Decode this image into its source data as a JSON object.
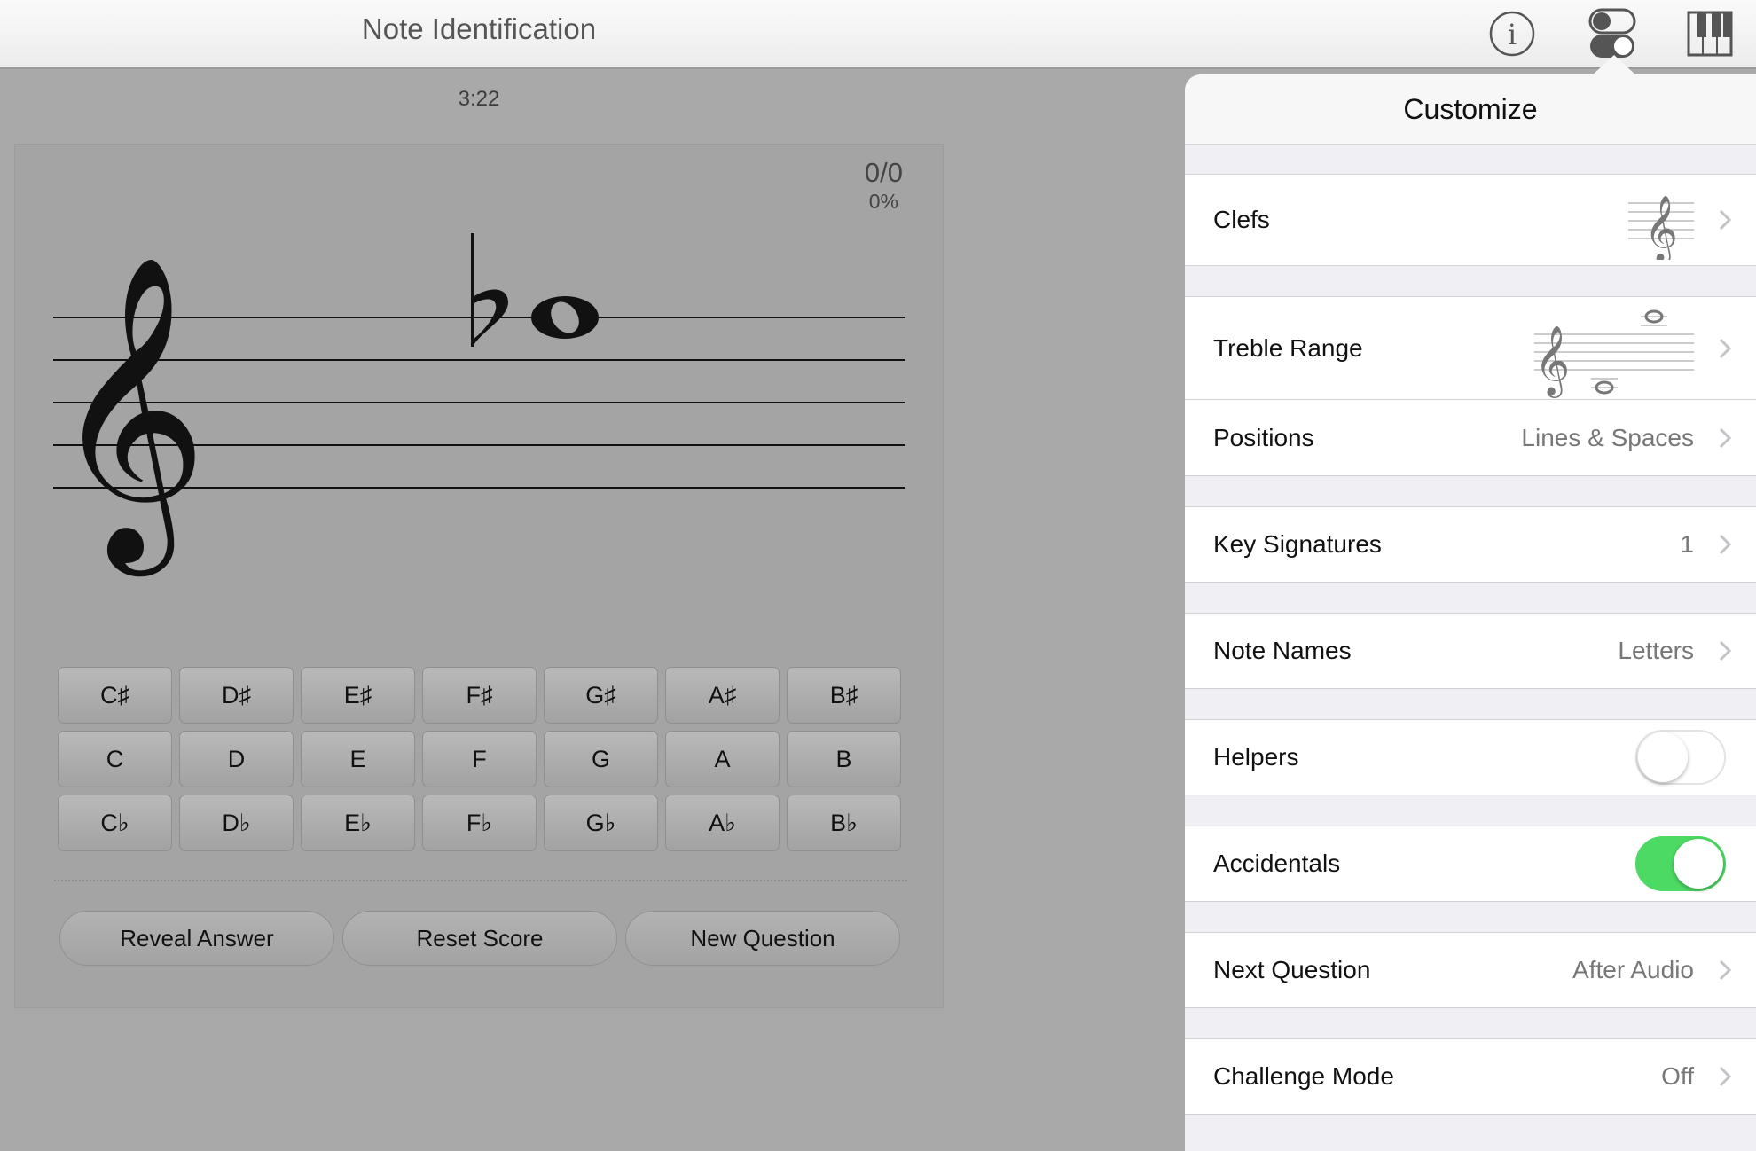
{
  "topbar": {
    "title": "Note Identification",
    "icons": [
      "info-icon",
      "toggles-icon",
      "piano-icon"
    ]
  },
  "timer": "3:22",
  "score": {
    "count": "0/0",
    "percent": "0%"
  },
  "staff": {
    "clef": "treble",
    "note_accidental": "flat",
    "note_type": "whole"
  },
  "note_buttons": [
    [
      "C♯",
      "D♯",
      "E♯",
      "F♯",
      "G♯",
      "A♯",
      "B♯"
    ],
    [
      "C",
      "D",
      "E",
      "F",
      "G",
      "A",
      "B"
    ],
    [
      "C♭",
      "D♭",
      "E♭",
      "F♭",
      "G♭",
      "A♭",
      "B♭"
    ]
  ],
  "actions": {
    "reveal": "Reveal Answer",
    "reset": "Reset Score",
    "new_question": "New Question"
  },
  "customize": {
    "title": "Customize",
    "rows": {
      "clefs": {
        "label": "Clefs"
      },
      "treble_range": {
        "label": "Treble Range"
      },
      "positions": {
        "label": "Positions",
        "value": "Lines & Spaces"
      },
      "key_signatures": {
        "label": "Key Signatures",
        "value": "1"
      },
      "note_names": {
        "label": "Note Names",
        "value": "Letters"
      },
      "helpers": {
        "label": "Helpers",
        "toggle": false
      },
      "accidentals": {
        "label": "Accidentals",
        "toggle": true
      },
      "next_question": {
        "label": "Next Question",
        "value": "After Audio"
      },
      "challenge_mode": {
        "label": "Challenge Mode",
        "value": "Off"
      }
    }
  },
  "colors": {
    "toggle_on": "#4cd964",
    "overlay_bg": "#a9a9a9",
    "popover_bg": "#efeff4"
  }
}
